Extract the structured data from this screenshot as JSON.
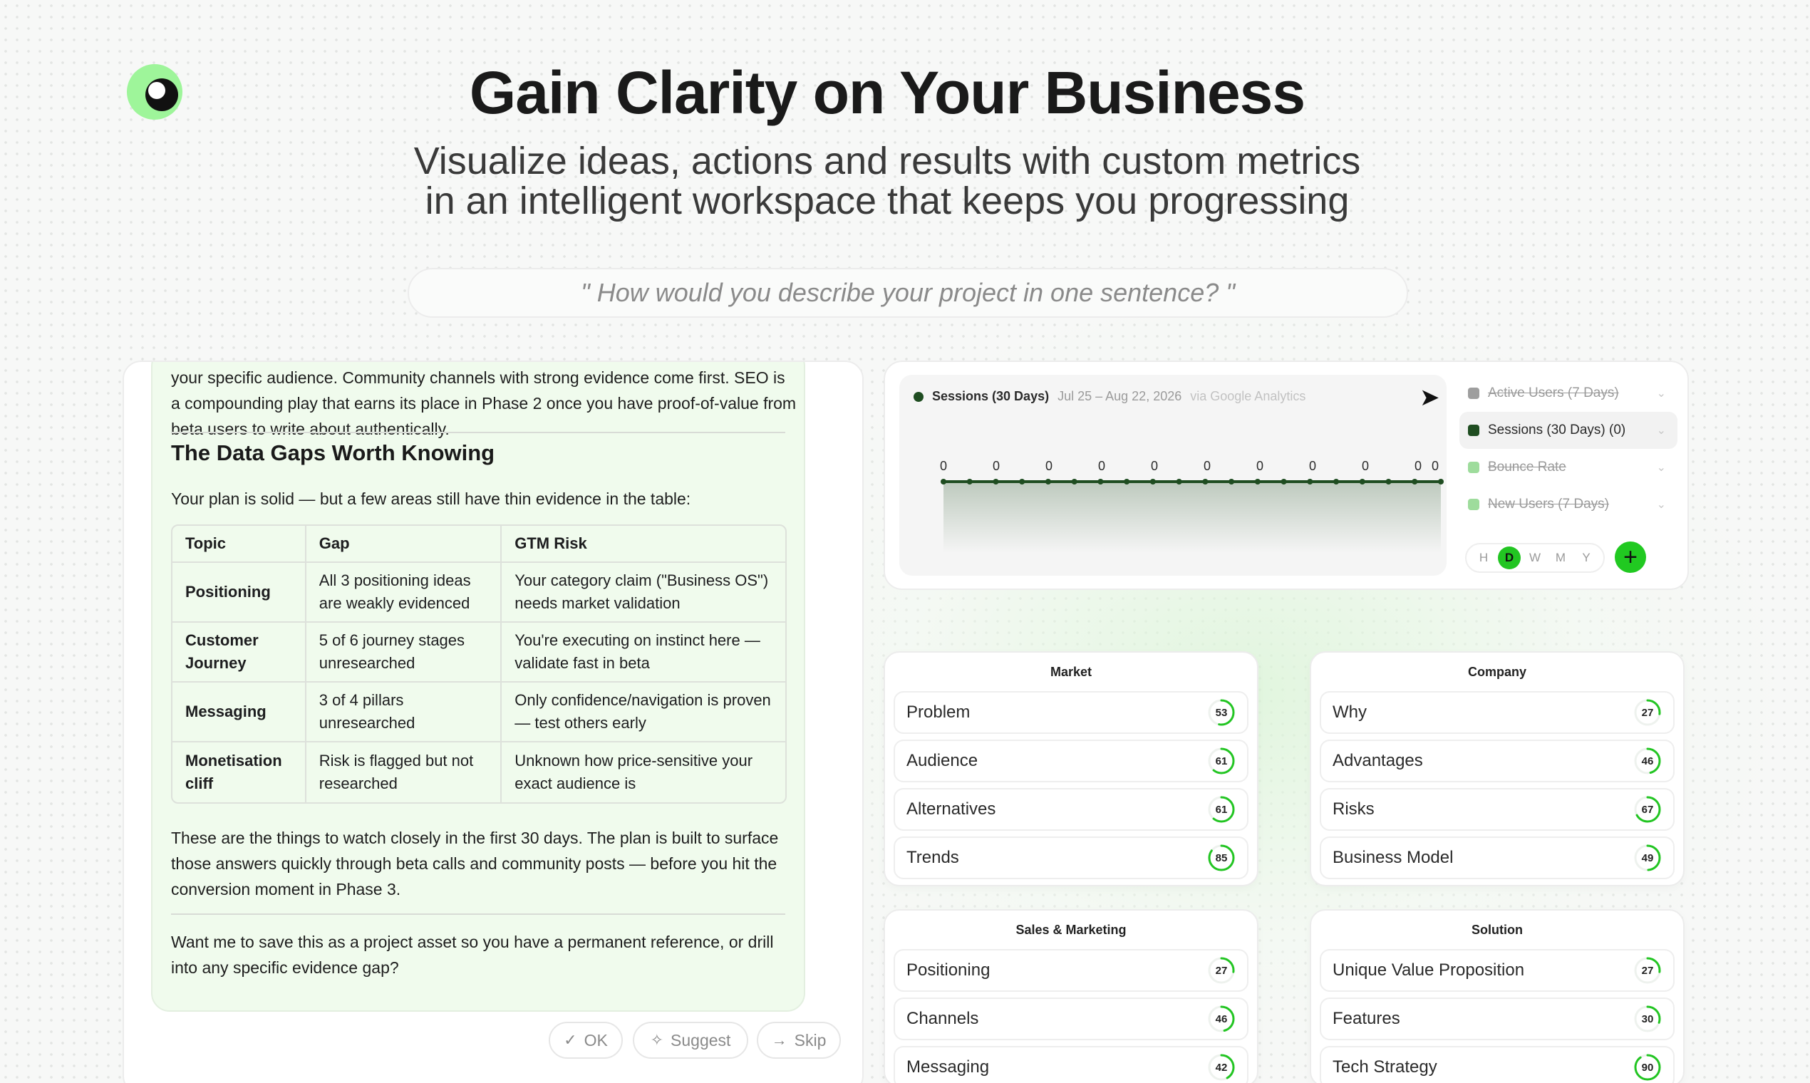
{
  "hero": {
    "title": "Gain Clarity on Your Business",
    "subtitle_line1": "Visualize ideas, actions and results with custom metrics",
    "subtitle_line2": "in an intelligent workspace that keeps you progressing",
    "prompt_placeholder": "\" How would you describe your project in one sentence? \""
  },
  "chat": {
    "para1": "your specific audience. Community channels with strong evidence come first. SEO is a compounding play that earns its place in Phase 2 once you have proof-of-value from beta users to write about authentically.",
    "heading": "The Data Gaps Worth Knowing",
    "intro": "Your plan is solid — but a few areas still have thin evidence in the table:",
    "table": {
      "headers": [
        "Topic",
        "Gap",
        "GTM Risk"
      ],
      "rows": [
        [
          "Positioning",
          "All 3 positioning ideas are weakly evidenced",
          "Your category claim (\"Business OS\") needs market validation"
        ],
        [
          "Customer Journey",
          "5 of 6 journey stages unresearched",
          "You're executing on instinct here — validate fast in beta"
        ],
        [
          "Messaging",
          "3 of 4 pillars unresearched",
          "Only confidence/navigation is proven — test others early"
        ],
        [
          "Monetisation cliff",
          "Risk is flagged but not researched",
          "Unknown how price-sensitive your exact audience is"
        ]
      ]
    },
    "para2": "These are the things to watch closely in the first 30 days. The plan is built to surface those answers quickly through beta calls and community posts — before you hit the conversion moment in Phase 3.",
    "para3": "Want me to save this as a project asset so you have a permanent reference, or drill into any specific evidence gap?",
    "actions": {
      "ok": "OK",
      "suggest": "Suggest",
      "skip": "Skip"
    }
  },
  "analytics": {
    "metric_name": "Sessions (30 Days)",
    "date_range": "Jul 25 – Aug 22, 2026",
    "source": "via Google Analytics",
    "metrics": [
      {
        "label": "Active Users (7 Days)",
        "color": "#9e9e9e",
        "struck": true,
        "active": false
      },
      {
        "label": "Sessions (30 Days) (0)",
        "color": "#1f4d21",
        "struck": false,
        "active": true
      },
      {
        "label": "Bounce Rate",
        "color": "#9edc9c",
        "struck": true,
        "active": false
      },
      {
        "label": "New Users (7 Days)",
        "color": "#9edc9c",
        "struck": true,
        "active": false
      }
    ],
    "periods": [
      "H",
      "D",
      "W",
      "M",
      "Y"
    ],
    "selected_period": "D",
    "add_label": "+",
    "line_color": "#1f4d21"
  },
  "chart_data": {
    "type": "line",
    "x_count": 20,
    "values": [
      0,
      0,
      0,
      0,
      0,
      0,
      0,
      0,
      0,
      0,
      0,
      0,
      0,
      0,
      0,
      0,
      0,
      0,
      0,
      0
    ],
    "labels": [
      "0",
      "0",
      "0",
      "0",
      "0",
      "0",
      "0",
      "0",
      "0",
      "0",
      "0"
    ],
    "title": "Sessions (30 Days)",
    "ylim": [
      0,
      1
    ]
  },
  "categories": [
    {
      "title": "Market",
      "items": [
        {
          "label": "Problem",
          "score": 53
        },
        {
          "label": "Audience",
          "score": 61
        },
        {
          "label": "Alternatives",
          "score": 61
        },
        {
          "label": "Trends",
          "score": 85
        }
      ]
    },
    {
      "title": "Company",
      "items": [
        {
          "label": "Why",
          "score": 27
        },
        {
          "label": "Advantages",
          "score": 46
        },
        {
          "label": "Risks",
          "score": 67
        },
        {
          "label": "Business Model",
          "score": 49
        }
      ]
    },
    {
      "title": "Sales & Marketing",
      "items": [
        {
          "label": "Positioning",
          "score": 27
        },
        {
          "label": "Channels",
          "score": 46
        },
        {
          "label": "Messaging",
          "score": 42
        }
      ]
    },
    {
      "title": "Solution",
      "items": [
        {
          "label": "Unique Value Proposition",
          "score": 27
        },
        {
          "label": "Features",
          "score": 30
        },
        {
          "label": "Tech Strategy",
          "score": 90
        }
      ]
    }
  ],
  "colors": {
    "accent": "#21c921",
    "score_ring": "#22c522"
  }
}
